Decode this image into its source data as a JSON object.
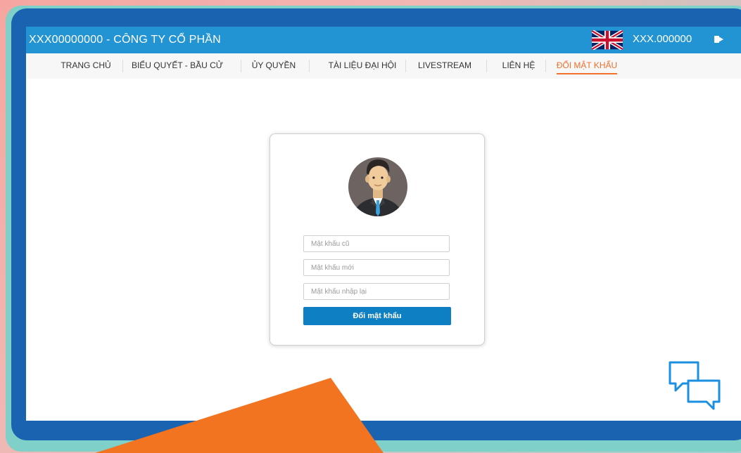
{
  "header": {
    "title": "XXX00000000 - CÔNG TY CỔ PHẦN",
    "user_code": "XXX.000000",
    "language_icon": "uk-flag-icon",
    "logout_icon": "logout-icon"
  },
  "nav": {
    "items": [
      {
        "label": "TRANG CHỦ"
      },
      {
        "label": "BIỂU QUYẾT - BẦU CỬ"
      },
      {
        "label": "ỦY QUYỀN"
      },
      {
        "label": "TÀI LIỆU ĐẠI HỘI"
      },
      {
        "label": "LIVESTREAM"
      },
      {
        "label": "LIÊN HỆ"
      },
      {
        "label": "ĐỔI MẬT KHẨU"
      }
    ],
    "active_index": 6
  },
  "form": {
    "old_password_placeholder": "Mật khẩu cũ",
    "new_password_placeholder": "Mật khẩu mới",
    "confirm_password_placeholder": "Mật khẩu nhập lại",
    "submit_label": "Đổi mật khẩu"
  },
  "colors": {
    "topbar": "#2293d3",
    "frame": "#1a63b1",
    "accent_active": "#f26f2c",
    "button": "#0e7fc2"
  },
  "icons": {
    "avatar": "user-avatar-icon",
    "chat": "chat-bubbles-icon"
  }
}
